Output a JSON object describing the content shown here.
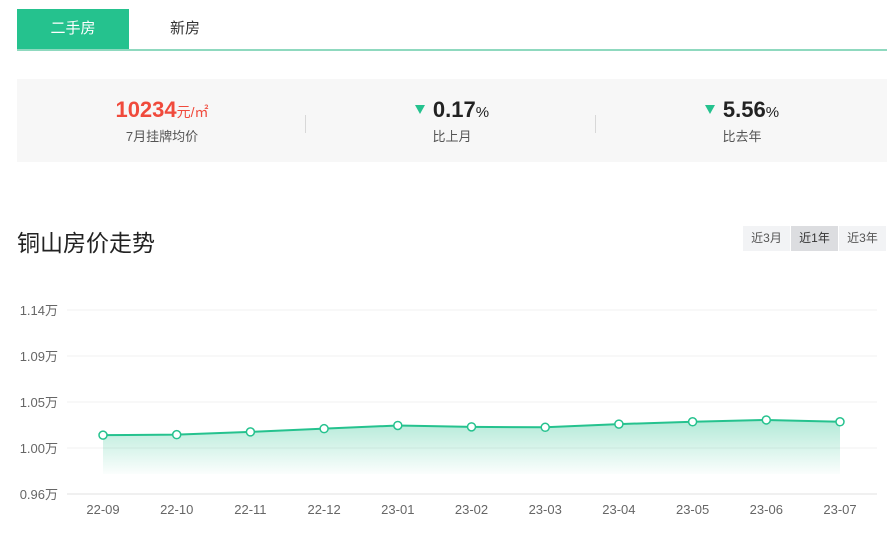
{
  "tabs": [
    {
      "label": "二手房",
      "active": true
    },
    {
      "label": "新房",
      "active": false
    }
  ],
  "stats": {
    "price": {
      "value": "10234",
      "unit": "元/㎡",
      "label": "7月挂牌均价"
    },
    "mom": {
      "value": "0.17",
      "unit": "%",
      "label": "比上月",
      "direction": "down"
    },
    "yoy": {
      "value": "5.56",
      "unit": "%",
      "label": "比去年",
      "direction": "down"
    }
  },
  "title": "铜山房价走势",
  "ranges": [
    {
      "label": "近3月",
      "active": false
    },
    {
      "label": "近1年",
      "active": true
    },
    {
      "label": "近3年",
      "active": false
    }
  ],
  "colors": {
    "accent": "#25c28e",
    "price": "#f04a3c"
  },
  "chart_data": {
    "type": "area",
    "categories": [
      "22-09",
      "22-10",
      "22-11",
      "22-12",
      "23-01",
      "23-02",
      "23-03",
      "23-04",
      "23-05",
      "23-06",
      "23-07"
    ],
    "values": [
      10140,
      10145,
      10175,
      10210,
      10245,
      10230,
      10225,
      10260,
      10285,
      10305,
      10285
    ],
    "yticks": [
      {
        "value": 9600,
        "label": "0.96万"
      },
      {
        "value": 10000,
        "label": "1.00万"
      },
      {
        "value": 10500,
        "label": "1.05万"
      },
      {
        "value": 10900,
        "label": "1.09万"
      },
      {
        "value": 11400,
        "label": "1.14万"
      }
    ],
    "grid": true
  }
}
